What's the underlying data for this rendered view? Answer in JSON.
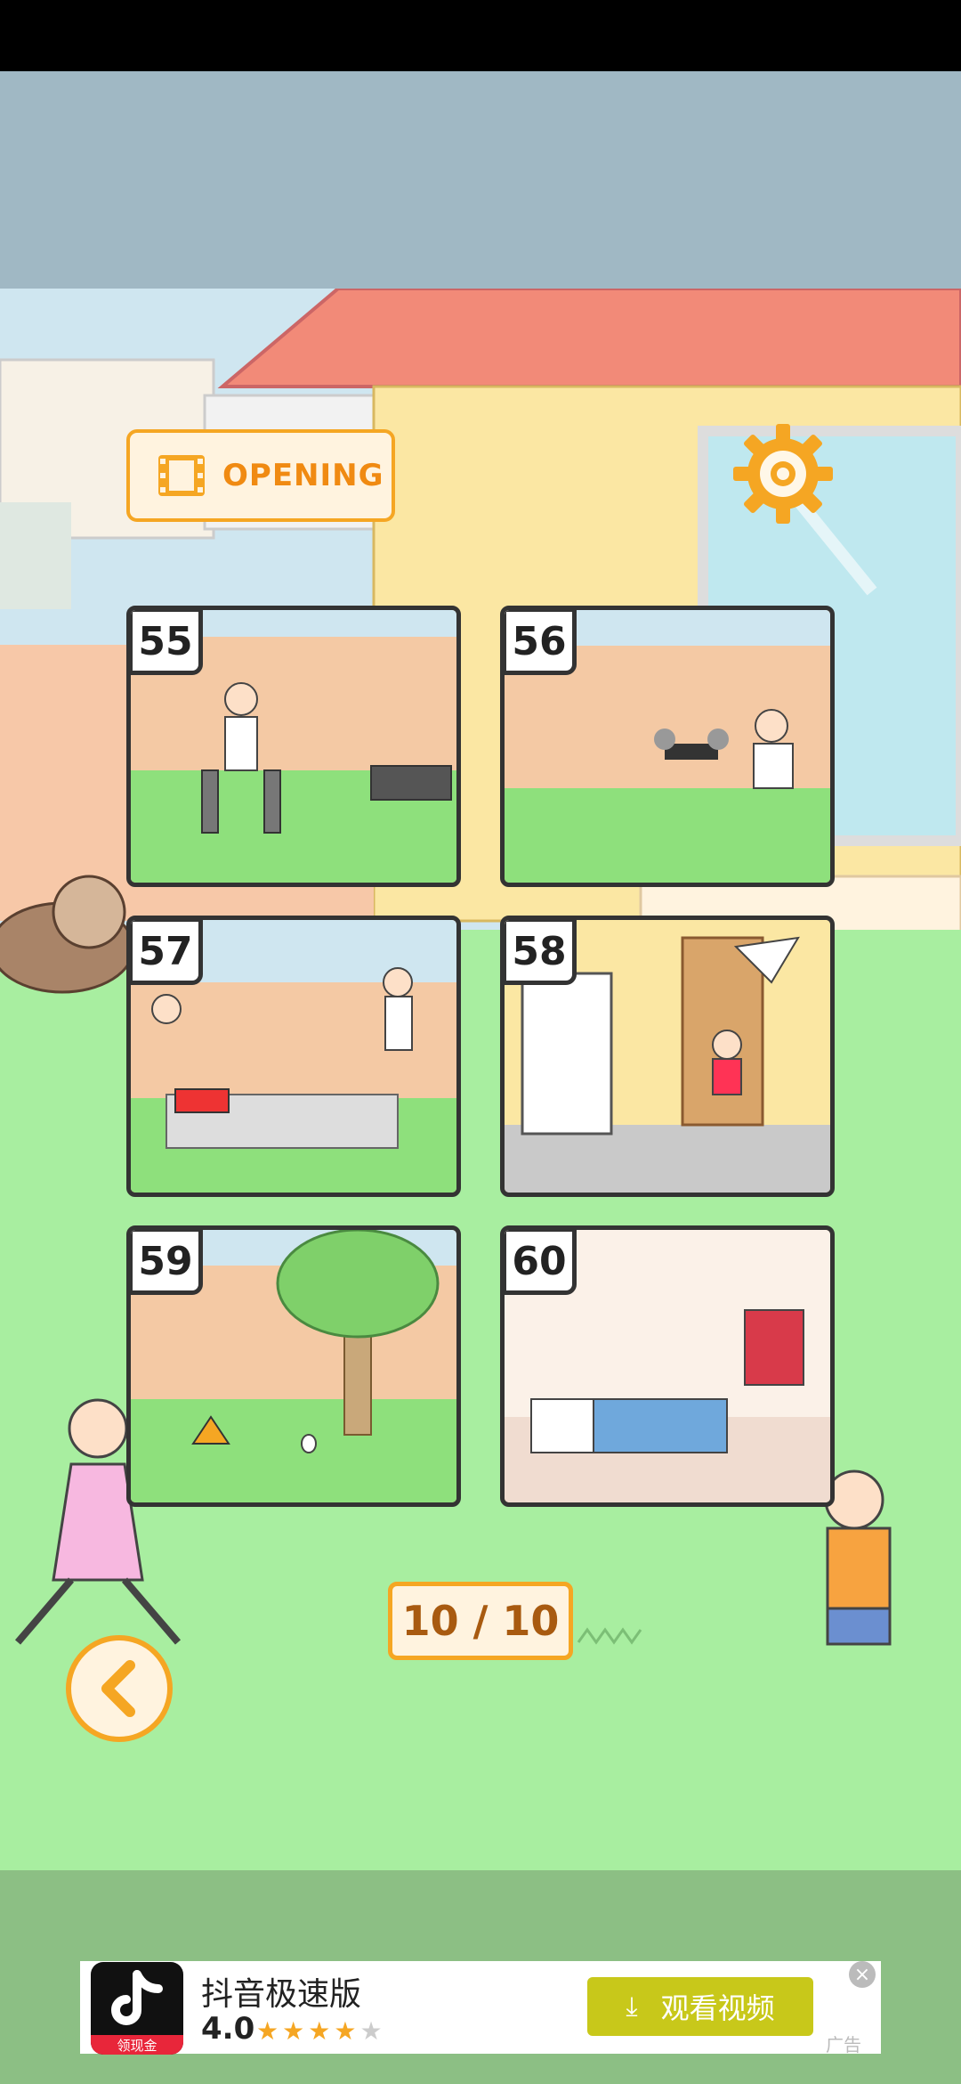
{
  "menu": {
    "opening_label": "OPENING",
    "settings_icon": "gear-icon"
  },
  "levels": [
    {
      "number": "55"
    },
    {
      "number": "56"
    },
    {
      "number": "57"
    },
    {
      "number": "58"
    },
    {
      "number": "59"
    },
    {
      "number": "60"
    }
  ],
  "pagination": {
    "indicator": "10 / 10"
  },
  "navigation": {
    "back_icon": "chevron-left-icon"
  },
  "ad": {
    "app_name": "抖音极速版",
    "badge": "领现金",
    "rating": "4.0",
    "stars_filled": 4,
    "stars_total": 5,
    "cta_label": "观看视频",
    "tag": "广告",
    "close_symbol": "×"
  },
  "colors": {
    "accent": "#f5a623",
    "grass": "#a8eea0",
    "ad_button": "#c8c81a"
  }
}
